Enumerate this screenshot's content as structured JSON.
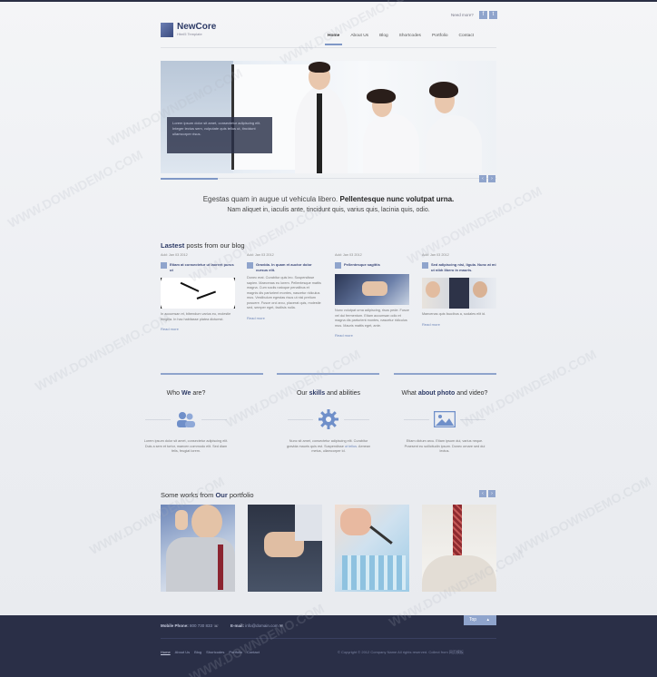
{
  "header": {
    "logo_title": "NewCore",
    "logo_sub": "Html5 Template",
    "need_more": "Need more?",
    "social_a": "f",
    "social_b": "t"
  },
  "nav": {
    "items": [
      "Home",
      "About Us",
      "Blog",
      "Shortcodes",
      "Portfolio",
      "Contact"
    ],
    "active": "Home"
  },
  "slider": {
    "caption": "Lorem ipsum dolor sit amet, consectetur adipiscing elit. Integer lectus sem, vulputate quis tellus ut, tincidunt ullamcorper risus.",
    "prev": "‹",
    "next": "›"
  },
  "intro": {
    "line1_plain": "Egestas quam in augue ut vehicula libero.",
    "line1_bold": "Pellentesque nunc volutpat urna.",
    "line2": "Nam aliquet in, iaculis ante, tincidunt quis, varius quis, lacinia quis, odio."
  },
  "blog": {
    "title_bold": "Lastest",
    "title_rest": "posts from our blog",
    "posts": [
      {
        "date": "Add: Jan 03 2012",
        "title": "Etiam at consectetur ut laoreet purus ut",
        "text": "In accumsan et, bibendum varius eu, molestie fringilla. In hac habitasse platea dictumst.",
        "more": "Read more"
      },
      {
        "date": "Add: Jan 03 2012",
        "title": "Gravida. In quam et auctor dolor cursus elit.",
        "text": "Donec erat. Curabitur quis leo. Suspendisse sapien. Maecenas eu lorem. Pellentesque mattis magna. Cum sociis natoque penatibus et magnis dis parturient montes, nascetur ridiculus mus. Vestibulum egestas risus ut nisl pretium posuere. Fusce orci arcu, placerat quis, molestie sed, semper eget, facilisis nulla.",
        "more": "Read more"
      },
      {
        "date": "Add: Jan 03 2012",
        "title": "Pellentesque sagittis",
        "text": "Nunc volutpat urna adipiscing, risus pede. Fusce vel dui fermentum. Etiam accumsan odio et magna dis parturient montes, nascetur ridiculus mus. Mauris mattis eget, ante.",
        "more": "Read more"
      },
      {
        "date": "Add: Jan 03 2012",
        "title": "Sed adipiscing nisi, ligula. Nunc at mi ut nibh libero in mauris.",
        "text": "Maecenas quis faucibus a, sodales elit id.",
        "more": "Read more"
      }
    ]
  },
  "services": [
    {
      "plain_a": "Who",
      "bold": "We",
      "plain_b": "are?",
      "icon": "users-icon",
      "text": "Lorem ipsum dolor sit amet, consectetur adipiscing elit. Duis a sem et tortor, maecen commodo elit. Sed diam felis, feugiat lorem.",
      "link": ""
    },
    {
      "plain_a": "Our",
      "bold": "skills",
      "plain_b": "and abilities",
      "icon": "gear-icon",
      "text": "Nunc sit amet, consectetur adipiscing elit. Curabitur gravida mauris quis est. Suspendisse",
      "link": "ut tellus",
      "tail": ". Aenean metus, ullamcorper id."
    },
    {
      "plain_a": "What",
      "bold": "about photo",
      "plain_b": "and video?",
      "icon": "picture-icon",
      "text": "Etiam dictum arcu. Etiam ipsum dui, varius neque. Praesent eu sollicitudin ipsum. Donec ornare sed dui lectus.",
      "link": ""
    }
  ],
  "portfolio": {
    "title_plain": "Some works from",
    "title_bold": "Our",
    "title_tail": "portfolio"
  },
  "footer": {
    "phone_label": "Mobile Phone:",
    "phone_value": "800 730 833",
    "email_label": "E-mail:",
    "email_value": "info@domain.com",
    "go_button": "Top",
    "links": [
      "Home",
      "About Us",
      "Blog",
      "Shortcodes",
      "Portfolio",
      "Contact"
    ],
    "copyright": "© Copyright © 2012 Company Name All rights reserved. Collect from 网页模板"
  },
  "colors": {
    "accent": "#8fa4cc",
    "navy": "#2a2f47",
    "title_blue": "#2d3a66"
  },
  "watermark": "WWW.DOWNDEMO.COM"
}
